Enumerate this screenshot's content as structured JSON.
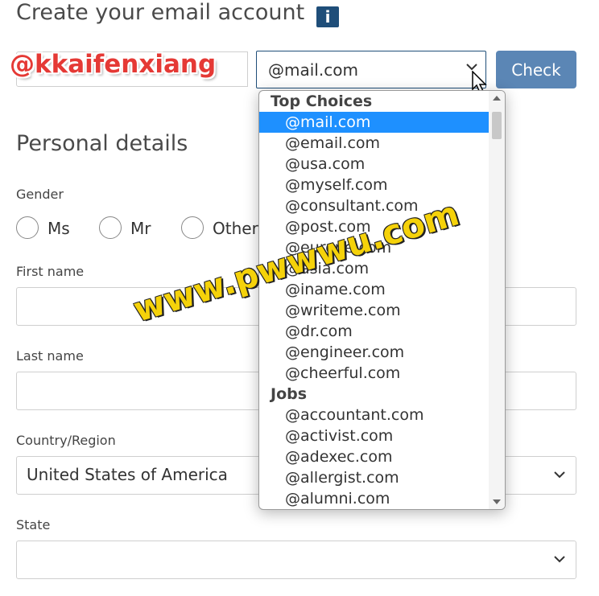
{
  "header": {
    "title": "Create your email account",
    "info_icon": "i"
  },
  "account": {
    "username_watermark": "@kkaifenxiang",
    "domain_value": "@mail.com",
    "check_label": "Check"
  },
  "personal": {
    "section_title": "Personal details",
    "gender_label": "Gender",
    "gender_options": [
      "Ms",
      "Mr",
      "Other"
    ],
    "first_name_label": "First name",
    "last_name_label": "Last name",
    "country_label": "Country/Region",
    "country_value": "United States of America",
    "state_label": "State",
    "state_value": ""
  },
  "dropdown": {
    "groups": [
      {
        "label": "Top Choices",
        "options": [
          "@mail.com",
          "@email.com",
          "@usa.com",
          "@myself.com",
          "@consultant.com",
          "@post.com",
          "@europe.com",
          "@asia.com",
          "@iname.com",
          "@writeme.com",
          "@dr.com",
          "@engineer.com",
          "@cheerful.com"
        ]
      },
      {
        "label": "Jobs",
        "options": [
          "@accountant.com",
          "@activist.com",
          "@adexec.com",
          "@allergist.com",
          "@alumni.com"
        ]
      }
    ],
    "selected": "@mail.com"
  },
  "watermark": {
    "site": "www.pwwwu.com"
  },
  "colors": {
    "accent": "#1f4e79",
    "button": "#5b86b5",
    "selected": "#1e90ff",
    "watermark_red": "#e53935",
    "watermark_yellow": "#f5d20a"
  }
}
